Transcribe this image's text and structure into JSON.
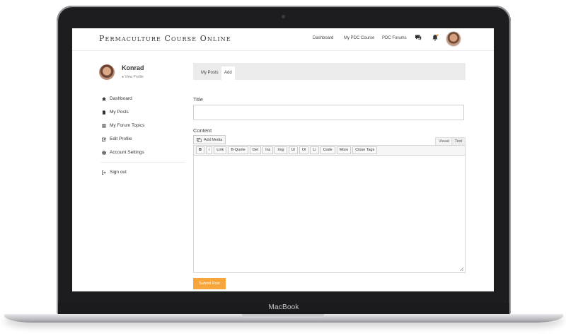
{
  "device": {
    "label": "MacBook"
  },
  "header": {
    "brand": "Permaculture Course Online",
    "nav": [
      "Dashboard",
      "My PDC Course",
      "PDC Forums"
    ],
    "icons": [
      "chat-icon",
      "bell-icon"
    ]
  },
  "profile": {
    "name": "Konrad",
    "link_label": "View Profile"
  },
  "sidebar": {
    "items": [
      {
        "label": "Dashboard",
        "icon": "home-icon"
      },
      {
        "label": "My Posts",
        "icon": "document-icon"
      },
      {
        "label": "My Forum Topics",
        "icon": "list-icon"
      },
      {
        "label": "Edit Profile",
        "icon": "edit-icon"
      },
      {
        "label": "Account Settings",
        "icon": "gear-icon"
      }
    ],
    "signout": {
      "label": "Sign out",
      "icon": "signout-icon"
    }
  },
  "tabs": [
    {
      "label": "My Posts"
    },
    {
      "label": "Add"
    }
  ],
  "form": {
    "title_label": "Title",
    "title_value": "",
    "content_label": "Content",
    "add_media": "Add Media",
    "modes": [
      "Visual",
      "Text"
    ],
    "toolbar": [
      "B",
      "i",
      "Link",
      "B-Quote",
      "Del",
      "Ins",
      "Img",
      "Ul",
      "Ol",
      "Li",
      "Code",
      "More",
      "Close Tags"
    ],
    "submit": "Submit Post"
  },
  "colors": {
    "accent": "#f7a63b",
    "tab_bar": "#ebebeb",
    "laptop": "#1d1d1f"
  }
}
